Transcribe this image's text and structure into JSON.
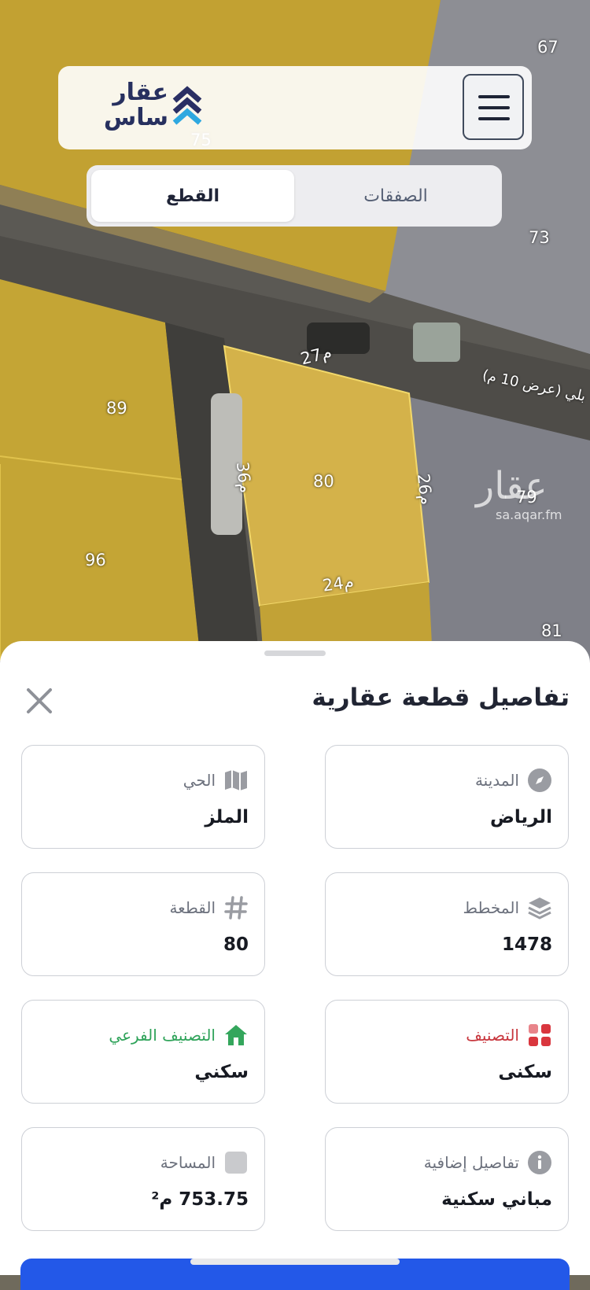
{
  "map": {
    "plot_numbers": [
      "67",
      "75",
      "73",
      "89",
      "80",
      "79",
      "96",
      "81"
    ],
    "dimensions": [
      "27م",
      "36م",
      "26م",
      "24م"
    ],
    "street_label": "بلي (عرض 10 م)",
    "watermark": {
      "brand": "عقار",
      "domain": "sa.aqar.fm"
    },
    "colors": {
      "plot_fill": "#c9a935",
      "highlight_fill": "#d9b64a",
      "road": "#55534e",
      "building": "#8c8d93"
    }
  },
  "header": {
    "logo_text_line1": "عقار",
    "logo_text_line2": "ساس",
    "logo_icon": "chevrons-up-icon",
    "menu_icon": "hamburger-icon"
  },
  "tabs": {
    "items": [
      {
        "label": "الصفقات",
        "active": false
      },
      {
        "label": "القطع",
        "active": true
      }
    ]
  },
  "sheet": {
    "title": "تفاصيل قطعة عقارية",
    "close_icon": "close-icon",
    "cards": [
      {
        "key": "city",
        "label": "المدينة",
        "value": "الرياض",
        "icon": "compass-icon"
      },
      {
        "key": "district",
        "label": "الحي",
        "value": "الملز",
        "icon": "map-icon"
      },
      {
        "key": "plan",
        "label": "المخطط",
        "value": "1478",
        "icon": "layers-icon"
      },
      {
        "key": "plot",
        "label": "القطعة",
        "value": "80",
        "icon": "hash-icon"
      },
      {
        "key": "classification",
        "label": "التصنيف",
        "value": "سكنى",
        "icon": "grid-icon",
        "color": "#c8373e"
      },
      {
        "key": "sub_classification",
        "label": "التصنيف الفرعي",
        "value": "سكني",
        "icon": "house-icon",
        "color": "#2fa35a"
      },
      {
        "key": "extra",
        "label": "تفاصيل إضافية",
        "value": "مباني سكنية",
        "icon": "info-icon"
      },
      {
        "key": "area",
        "label": "المساحة",
        "value": "753.75 م²",
        "icon": "square-icon"
      }
    ]
  },
  "accent_color": "#2358e8"
}
